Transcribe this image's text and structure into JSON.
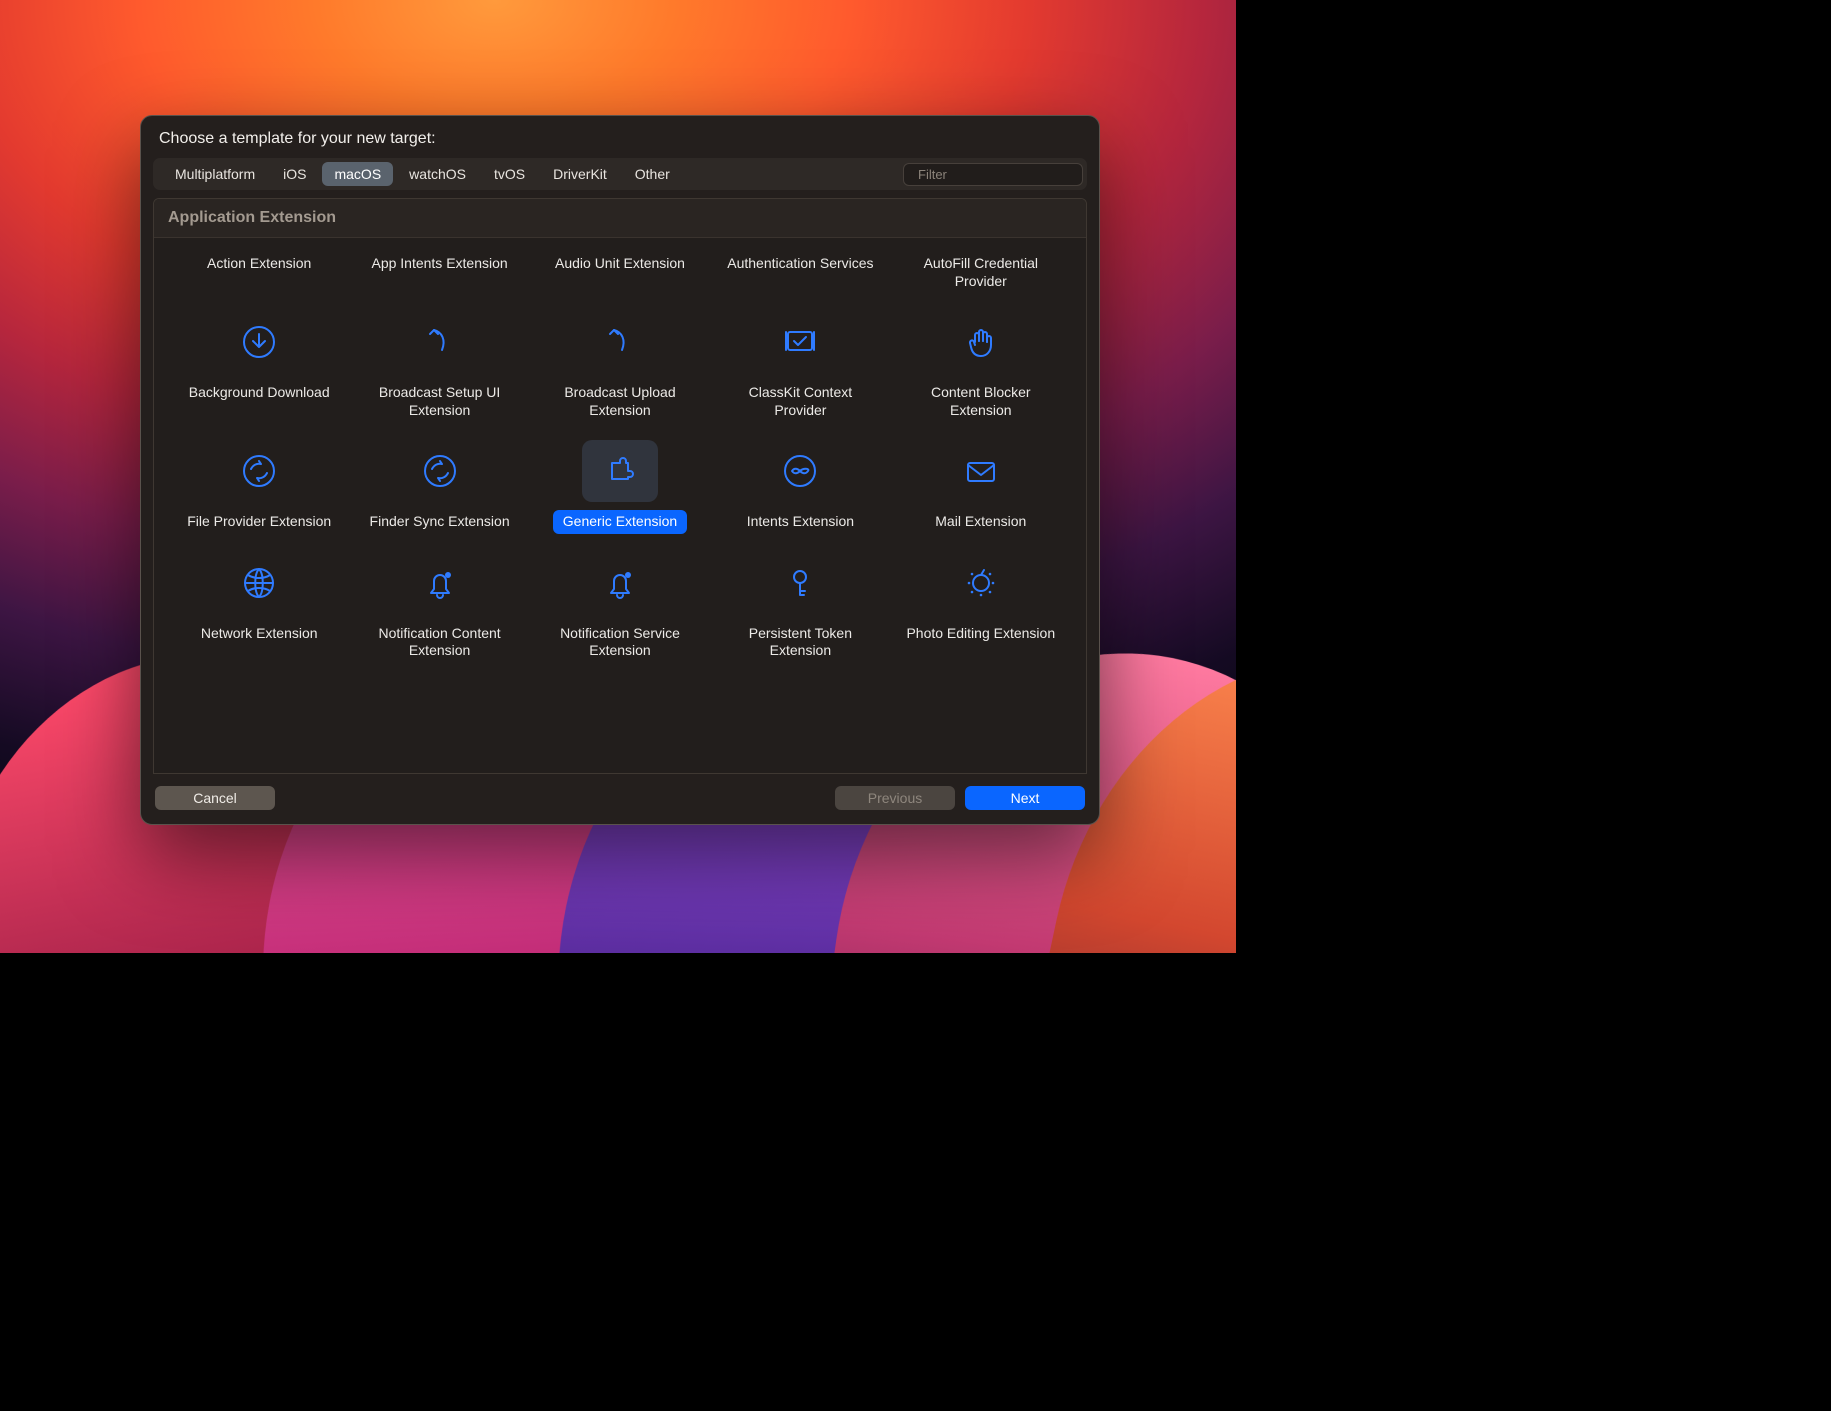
{
  "dialog": {
    "title": "Choose a template for your new target:"
  },
  "tabs": [
    "Multiplatform",
    "iOS",
    "macOS",
    "watchOS",
    "tvOS",
    "DriverKit",
    "Other"
  ],
  "active_tab_index": 2,
  "filter": {
    "placeholder": "Filter",
    "value": ""
  },
  "section_title": "Application Extension",
  "templates": [
    {
      "id": "action-extension",
      "label": "Action Extension",
      "icon": null
    },
    {
      "id": "app-intents-extension",
      "label": "App Intents Extension",
      "icon": null
    },
    {
      "id": "audio-unit-extension",
      "label": "Audio Unit Extension",
      "icon": null
    },
    {
      "id": "authentication-services",
      "label": "Authentication Services",
      "icon": null
    },
    {
      "id": "autofill-credential-provider",
      "label": "AutoFill Credential Provider",
      "icon": null
    },
    {
      "id": "background-download",
      "label": "Background Download",
      "icon": "arrow-down-circle"
    },
    {
      "id": "broadcast-setup-ui-extension",
      "label": "Broadcast Setup UI Extension",
      "icon": "arrow-redo"
    },
    {
      "id": "broadcast-upload-extension",
      "label": "Broadcast Upload Extension",
      "icon": "arrow-redo"
    },
    {
      "id": "classkit-context-provider",
      "label": "ClassKit Context Provider",
      "icon": "screen-check"
    },
    {
      "id": "content-blocker-extension",
      "label": "Content Blocker Extension",
      "icon": "hand"
    },
    {
      "id": "file-provider-extension",
      "label": "File Provider Extension",
      "icon": "sync-circle"
    },
    {
      "id": "finder-sync-extension",
      "label": "Finder Sync Extension",
      "icon": "sync-circle"
    },
    {
      "id": "generic-extension",
      "label": "Generic Extension",
      "icon": "puzzle",
      "selected": true
    },
    {
      "id": "intents-extension",
      "label": "Intents Extension",
      "icon": "infinity-circle"
    },
    {
      "id": "mail-extension",
      "label": "Mail Extension",
      "icon": "envelope"
    },
    {
      "id": "network-extension",
      "label": "Network Extension",
      "icon": "globe"
    },
    {
      "id": "notification-content-extension",
      "label": "Notification Content Extension",
      "icon": "bell-dot"
    },
    {
      "id": "notification-service-extension",
      "label": "Notification Service Extension",
      "icon": "bell-dot"
    },
    {
      "id": "persistent-token-extension",
      "label": "Persistent Token Extension",
      "icon": "key"
    },
    {
      "id": "photo-editing-extension",
      "label": "Photo Editing Extension",
      "icon": "dial"
    }
  ],
  "buttons": {
    "cancel": "Cancel",
    "previous": "Previous",
    "next": "Next"
  },
  "icons": {
    "arrow-down-circle": "<circle cx='20' cy='20' r='15'/><path d='M20 12v13M14 19l6 6 6-6'/>",
    "arrow-redo": "<path d='M14 8c8 2 12 10 8 20'/><path d='M10 12l4-4 4 4'/>",
    "screen-check": "<rect x='8' y='10' width='24' height='18' rx='2'/><path d='M14 19l4 4 8-8'/><path d='M6 10v18M34 10v18'/>",
    "hand": "<path d='M14 20v-7a2 2 0 0 1 4 0v6'/><path d='M18 19v-9a2 2 0 0 1 4 0v9'/><path d='M22 19v-7a2 2 0 0 1 4 0v8'/><path d='M26 20v-4a2 2 0 0 1 4 0v7c0 6-4 11-10 11s-9-4-10-9l-1-4a2 2 0 0 1 4-1l1 3'/>",
    "sync-circle": "<circle cx='20' cy='20' r='15'/><path d='M12 18c2-4 6-6 10-5l-2-3M28 22c-2 4-6 6-10 5l2 3'/>",
    "puzzle": "<path d='M12 12h8v-2a3 3 0 0 1 6 0v2h2v8h2a3 3 0 0 1 0 6h-2v2H12z'/>",
    "infinity-circle": "<circle cx='20' cy='20' r='15'/><path d='M12 20c2-3 5-3 8 0s6 3 8 0-5-3-8 0-6 3-8 0z'/>",
    "envelope": "<rect x='7' y='12' width='26' height='18' rx='2'/><path d='M7 14l13 10 13-10'/>",
    "globe": "<circle cx='20' cy='20' r='14'/><path d='M6 20h28M20 6c5 5 5 23 0 28M20 6c-5 5-5 23 0 28M9 12c6 4 16 4 22 0M9 28c6-4 16-4 22 0'/>",
    "bell-dot": "<path d='M14 26V18a6 6 0 0 1 12 0v8l3 4H11z'/><path d='M17 32a3 3 0 0 0 6 0'/><circle cx='28' cy='12' r='3' fill='#2f7bff' stroke='none'/>",
    "key": "<circle cx='20' cy='14' r='6'/><path d='M20 20v12M20 28h5M20 32h4'/>",
    "dial": "<circle cx='20' cy='20' r='8'/><path d='M20 12l3-5'/><circle cx='8' cy='20' r='1.3' fill='#2f7bff' stroke='none'/><circle cx='32' cy='20' r='1.3' fill='#2f7bff' stroke='none'/><circle cx='11' cy='11' r='1.3' fill='#2f7bff' stroke='none'/><circle cx='29' cy='11' r='1.3' fill='#2f7bff' stroke='none'/><circle cx='11' cy='29' r='1.3' fill='#2f7bff' stroke='none'/><circle cx='29' cy='29' r='1.3' fill='#2f7bff' stroke='none'/><circle cx='20' cy='32' r='1.3' fill='#2f7bff' stroke='none'/>"
  }
}
